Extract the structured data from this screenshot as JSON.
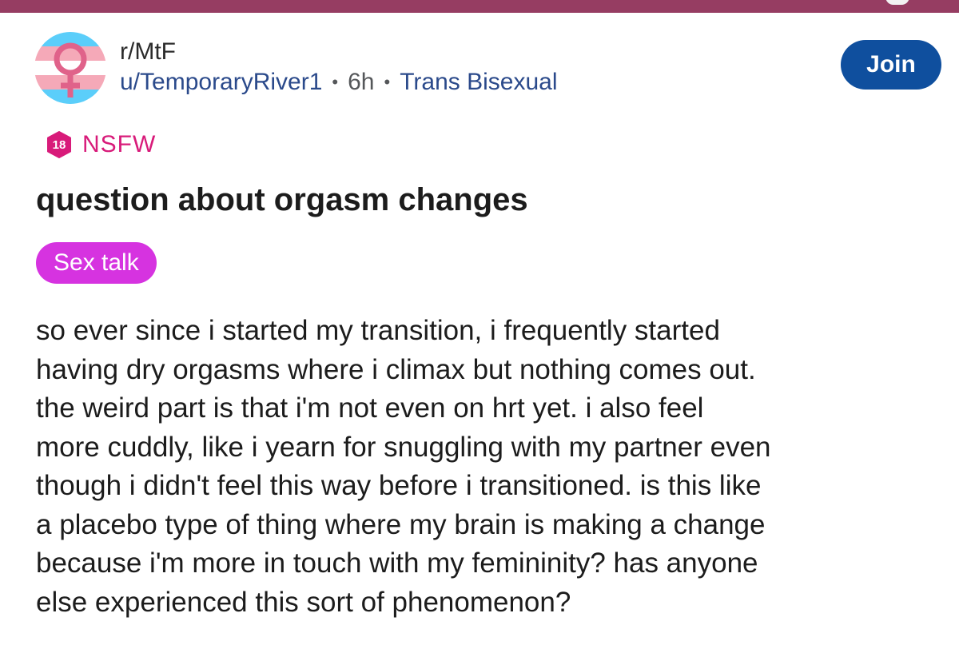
{
  "colors": {
    "header_bar": "#963d62",
    "link_blue": "#2b4a8b",
    "join_button": "#0f4f9e",
    "nsfw_pink": "#d81b7a",
    "flair_magenta": "#d633e0",
    "text_dark": "#1c1c1c"
  },
  "post": {
    "subreddit": "r/MtF",
    "author": "u/TemporaryRiver1",
    "age": "6h",
    "separator": "•",
    "user_flair": "Trans Bisexual",
    "join_label": "Join",
    "avatar_icon": "trans-flag-venus-icon",
    "nsfw": {
      "badge": "18",
      "label": "NSFW"
    },
    "title": "question about orgasm changes",
    "flair": "Sex talk",
    "body_lines": [
      "so ever since i started my transition, i frequently started",
      "having dry orgasms where i climax but nothing comes out.",
      "the weird part is that i'm not even on hrt yet. i also feel",
      "more cuddly, like i yearn for snuggling with my partner even",
      "though i didn't feel this way before i transitioned. is this like",
      "a placebo type of thing where my brain is making a change",
      "because i'm more in touch with my femininity? has anyone",
      "else experienced this sort of phenomenon?"
    ]
  }
}
